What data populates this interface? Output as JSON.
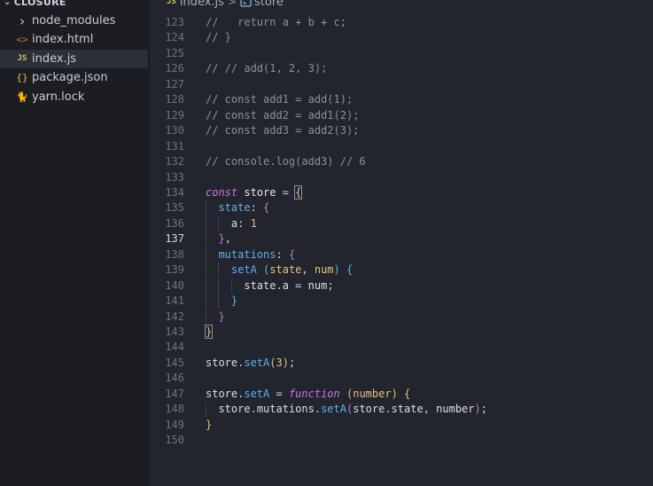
{
  "sidebar": {
    "section_title": "CLOSURE",
    "items": [
      {
        "label": "node_modules",
        "icon": "chevron-right-icon",
        "glyph": "›",
        "color": "#c9ccd3"
      },
      {
        "label": "index.html",
        "icon": "html-file-icon",
        "glyph": "<>",
        "color": "#e06c3c"
      },
      {
        "label": "index.js",
        "icon": "js-file-icon",
        "glyph": "JS",
        "color": "#d7c35a",
        "active": true
      },
      {
        "label": "package.json",
        "icon": "json-file-icon",
        "glyph": "{}",
        "color": "#d7c35a"
      },
      {
        "label": "yarn.lock",
        "icon": "yarn-icon",
        "glyph": "🐈",
        "color": "#5b9bd5"
      }
    ]
  },
  "breadcrumb": {
    "file_badge": "JS",
    "file": "index.js",
    "separator": ">",
    "symbol": "store"
  },
  "editor": {
    "current_line": 137,
    "lines": [
      {
        "n": "123",
        "t": [
          [
            "com",
            "//   return a + b + c;"
          ]
        ]
      },
      {
        "n": "124",
        "t": [
          [
            "com",
            "// }"
          ]
        ]
      },
      {
        "n": "125",
        "t": []
      },
      {
        "n": "126",
        "t": [
          [
            "com",
            "// // add(1, 2, 3);"
          ]
        ]
      },
      {
        "n": "127",
        "t": []
      },
      {
        "n": "128",
        "t": [
          [
            "com",
            "// const add1 = add(1);"
          ]
        ]
      },
      {
        "n": "129",
        "t": [
          [
            "com",
            "// const add2 = add1(2);"
          ]
        ]
      },
      {
        "n": "130",
        "t": [
          [
            "com",
            "// const add3 = add2(3);"
          ]
        ]
      },
      {
        "n": "131",
        "t": []
      },
      {
        "n": "132",
        "t": [
          [
            "com",
            "// console.log(add3) // 6"
          ]
        ]
      },
      {
        "n": "133",
        "t": []
      },
      {
        "n": "134",
        "t": [
          [
            "kw",
            "const"
          ],
          [
            "op",
            " "
          ],
          [
            "def",
            "store"
          ],
          [
            "op",
            " = "
          ],
          [
            "b1 matched",
            "{"
          ]
        ]
      },
      {
        "n": "135",
        "t": [
          [
            "op",
            "  "
          ],
          [
            "prop",
            "state"
          ],
          [
            "op",
            ": "
          ],
          [
            "b2",
            "{"
          ]
        ]
      },
      {
        "n": "136",
        "t": [
          [
            "op",
            "    "
          ],
          [
            "var",
            "a"
          ],
          [
            "op",
            ": "
          ],
          [
            "num",
            "1"
          ]
        ]
      },
      {
        "n": "137",
        "t": [
          [
            "op",
            "  "
          ],
          [
            "b2",
            "}"
          ],
          [
            "op",
            ","
          ]
        ]
      },
      {
        "n": "138",
        "t": [
          [
            "op",
            "  "
          ],
          [
            "prop",
            "mutations"
          ],
          [
            "op",
            ": "
          ],
          [
            "b2",
            "{"
          ]
        ]
      },
      {
        "n": "139",
        "t": [
          [
            "op",
            "    "
          ],
          [
            "fn",
            "setA"
          ],
          [
            "op",
            " "
          ],
          [
            "b3",
            "("
          ],
          [
            "param",
            "state"
          ],
          [
            "op",
            ", "
          ],
          [
            "param",
            "num"
          ],
          [
            "b3",
            ")"
          ],
          [
            "op",
            " "
          ],
          [
            "b3",
            "{"
          ]
        ]
      },
      {
        "n": "140",
        "t": [
          [
            "op",
            "      "
          ],
          [
            "var",
            "state"
          ],
          [
            "op",
            "."
          ],
          [
            "var",
            "a"
          ],
          [
            "op",
            " = "
          ],
          [
            "var",
            "num"
          ],
          [
            "op",
            ";"
          ]
        ]
      },
      {
        "n": "141",
        "t": [
          [
            "op",
            "    "
          ],
          [
            "b3",
            "}"
          ]
        ]
      },
      {
        "n": "142",
        "t": [
          [
            "op",
            "  "
          ],
          [
            "b2",
            "}"
          ]
        ]
      },
      {
        "n": "143",
        "t": [
          [
            "b1 matched",
            "}"
          ]
        ]
      },
      {
        "n": "144",
        "t": []
      },
      {
        "n": "145",
        "t": [
          [
            "var",
            "store"
          ],
          [
            "op",
            "."
          ],
          [
            "fn",
            "setA"
          ],
          [
            "b1",
            "("
          ],
          [
            "num",
            "3"
          ],
          [
            "b1",
            ")"
          ],
          [
            "op",
            ";"
          ]
        ]
      },
      {
        "n": "146",
        "t": []
      },
      {
        "n": "147",
        "t": [
          [
            "var",
            "store"
          ],
          [
            "op",
            "."
          ],
          [
            "fn",
            "setA"
          ],
          [
            "op",
            " = "
          ],
          [
            "kw",
            "function"
          ],
          [
            "op",
            " "
          ],
          [
            "b1",
            "("
          ],
          [
            "param",
            "number"
          ],
          [
            "b1",
            ")"
          ],
          [
            "op",
            " "
          ],
          [
            "b1",
            "{"
          ]
        ]
      },
      {
        "n": "148",
        "t": [
          [
            "op",
            "  "
          ],
          [
            "var",
            "store"
          ],
          [
            "op",
            "."
          ],
          [
            "var",
            "mutations"
          ],
          [
            "op",
            "."
          ],
          [
            "fn",
            "setA"
          ],
          [
            "b2",
            "("
          ],
          [
            "var",
            "store"
          ],
          [
            "op",
            "."
          ],
          [
            "var",
            "state"
          ],
          [
            "op",
            ", "
          ],
          [
            "var",
            "number"
          ],
          [
            "b2",
            ")"
          ],
          [
            "op",
            ";"
          ]
        ]
      },
      {
        "n": "149",
        "t": [
          [
            "b1",
            "}"
          ]
        ]
      },
      {
        "n": "150",
        "t": []
      }
    ]
  }
}
